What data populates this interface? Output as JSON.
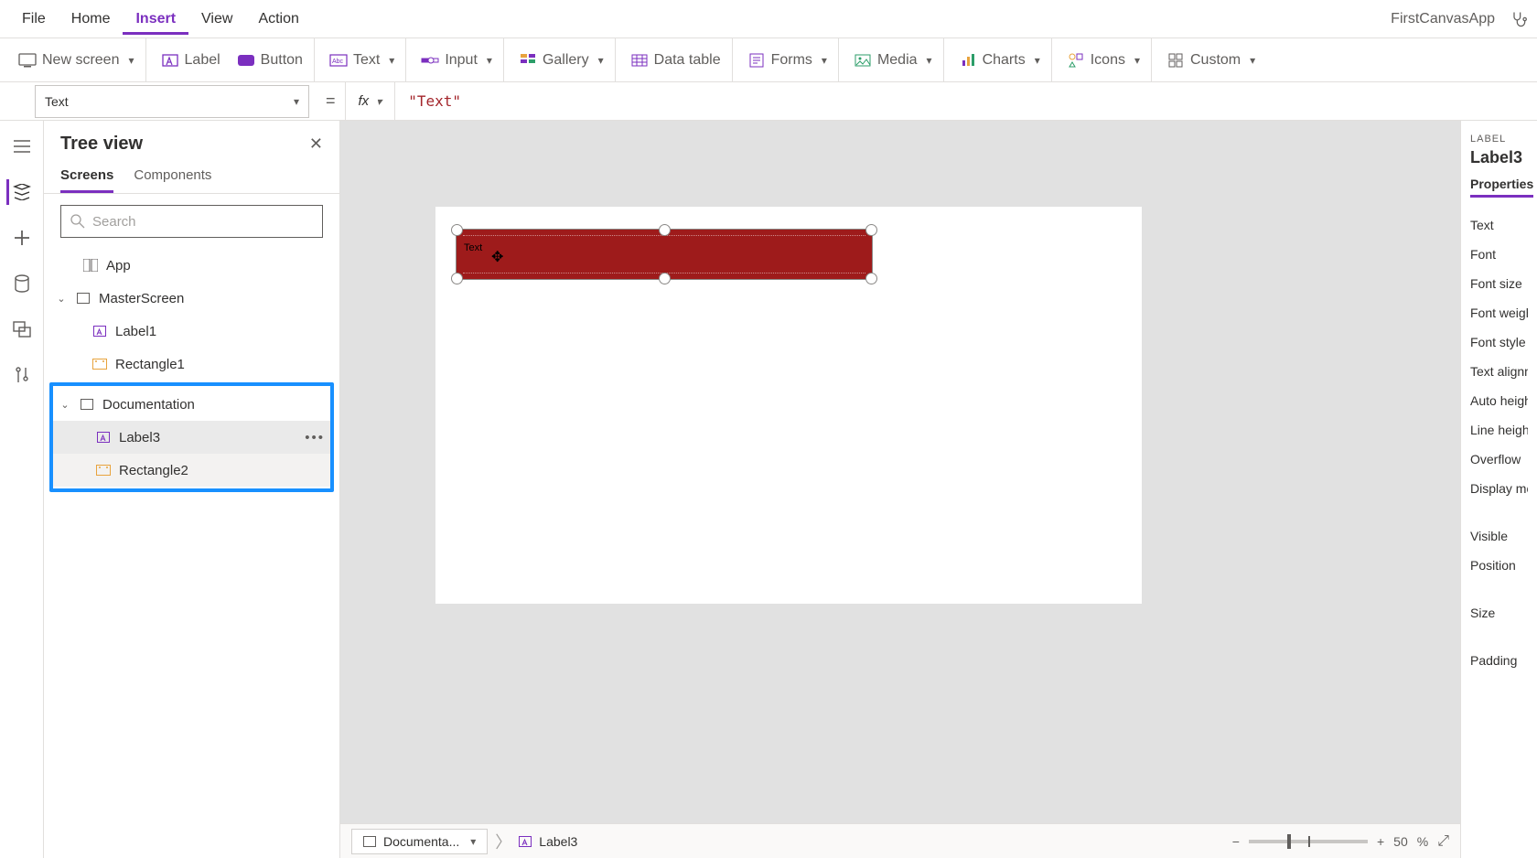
{
  "app_name": "FirstCanvasApp",
  "menu": {
    "file": "File",
    "home": "Home",
    "insert": "Insert",
    "view": "View",
    "action": "Action"
  },
  "ribbon": {
    "new_screen": "New screen",
    "label": "Label",
    "button": "Button",
    "text": "Text",
    "input": "Input",
    "gallery": "Gallery",
    "data_table": "Data table",
    "forms": "Forms",
    "media": "Media",
    "charts": "Charts",
    "icons": "Icons",
    "custom": "Custom"
  },
  "formula": {
    "property": "Text",
    "value": "\"Text\""
  },
  "tree": {
    "title": "Tree view",
    "tab_screens": "Screens",
    "tab_components": "Components",
    "search_placeholder": "Search",
    "app": "App",
    "master": "MasterScreen",
    "label1": "Label1",
    "rect1": "Rectangle1",
    "doc": "Documentation",
    "label3": "Label3",
    "rect2": "Rectangle2"
  },
  "canvas_label_text": "Text",
  "breadcrumb": {
    "screen": "Documenta...",
    "control": "Label3"
  },
  "zoom": {
    "value": "50",
    "unit": "%"
  },
  "props": {
    "type": "LABEL",
    "name": "Label3",
    "tab": "Properties",
    "rows": [
      "Text",
      "Font",
      "Font size",
      "Font weight",
      "Font style",
      "Text alignment",
      "Auto height",
      "Line height",
      "Overflow",
      "Display mode"
    ],
    "rows2": [
      "Visible",
      "Position"
    ],
    "rows3": [
      "Size"
    ],
    "rows4": [
      "Padding"
    ]
  }
}
